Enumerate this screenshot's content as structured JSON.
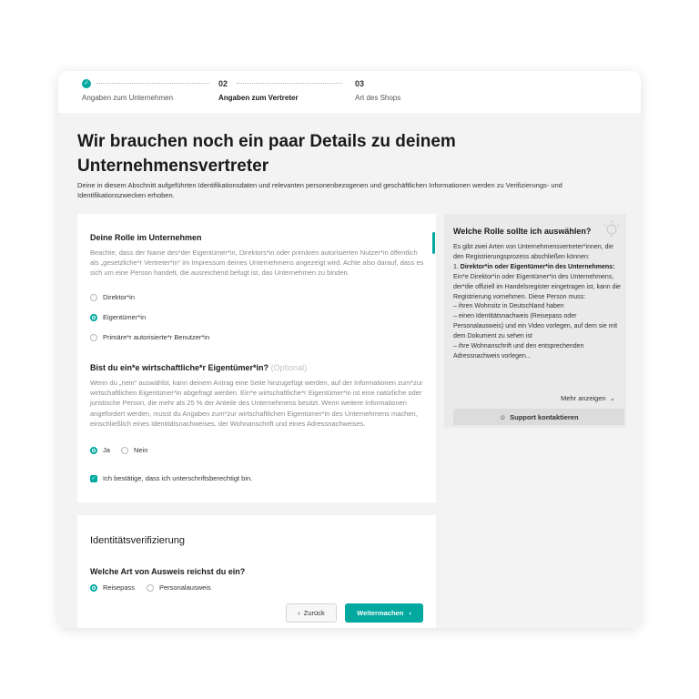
{
  "stepper": {
    "step1": {
      "label": "Angaben zum Unternehmen"
    },
    "step2": {
      "num": "02",
      "label": "Angaben zum Vertreter"
    },
    "step3": {
      "num": "03",
      "label": "Art des Shops"
    }
  },
  "header": {
    "title_line1": "Wir brauchen noch ein paar Details zu deinem",
    "title_line2": "Unternehmensvertreter",
    "intro": "Deine in diesem Abschnitt aufgeführten Identifikationsdaten und relevanten personenbezogenen und geschäftlichen Informationen werden zu Verifizierungs- und Identifikationszwecken erhoben."
  },
  "role": {
    "heading": "Deine Rolle im Unternehmen",
    "description": "Beachte, dass der Name des*der Eigentümer*in, Direktors*in oder primären autorisierten Nutzer*in öffentlich als „gesetzliche*r Vertreter*in“ im Impressum deines Unternehmens angezeigt wird. Achte also darauf, dass es sich um eine Person handelt, die ausreichend befugt ist, das Unternehmen zu binden.",
    "options": [
      "Direktor*in",
      "Eigentümer*in",
      "Primäre*r autorisierte*r Benutzer*in"
    ],
    "selected_index": 1
  },
  "owner": {
    "heading": "Bist du ein*e wirtschaftliche*r Eigentümer*in?",
    "optional": "(Optional)",
    "description": "Wenn du „nein“ auswählst, kann deinem Antrag eine Seite hinzugefügt werden, auf der Informationen zum*zur wirtschaftlichen Eigentümer*in abgefragt werden. Ein*e wirtschaftliche*r Eigentümer*in ist eine natürliche oder juristische Person, die mehr als 25 % der Anteile des Unternehmens besitzt. Wenn weitere Informationen angefordert werden, musst du Angaben zum*zur wirtschaftlichen Eigentümer*in des Unternehmens machen, einschließlich eines Identitätsnachweises, der Wohnanschrift und eines Adressnachweises.",
    "yes": "Ja",
    "no": "Nein",
    "selected": "Ja"
  },
  "confirm": {
    "label": "Ich bestätige, dass ich unterschriftsberechtigt bin.",
    "checked": true
  },
  "identity": {
    "heading": "Identitätsverifizierung",
    "question": "Welche Art von Ausweis reichst du ein?",
    "options": [
      "Reisepass",
      "Personalausweis"
    ],
    "selected": "Reisepass"
  },
  "sidebar": {
    "title": "Welche Rolle sollte ich auswählen?",
    "intro": "Es gibt zwei Arten von Unternehmensvertreter*innen, die den Registrierungsprozess abschließen können:",
    "point_num": "1.",
    "point_bold": "Direktor*in oder Eigentümer*in des Unternehmens:",
    "point_text": "Ein*e Direktor*in oder Eigentümer*in des Unternehmens, der*die offiziell im Handelsregister eingetragen ist, kann die Registrierung vornehmen. Diese Person muss:",
    "bullet1": "– ihren Wohnsitz in Deutschland haben",
    "bullet2": "– einen Identitätsnachweis (Reisepass oder Personalausweis) und ein Video vorlegen, auf dem sie mit dem Dokument zu sehen ist",
    "bullet3": "– ihre Wohnanschrift und den entsprechenden Adressnachweis vorlegen...",
    "more": "Mehr anzeigen",
    "support": "Support kontaktieren"
  },
  "buttons": {
    "back": "Zurück",
    "next": "Weitermachen"
  },
  "colors": {
    "accent": "#00a89f"
  }
}
